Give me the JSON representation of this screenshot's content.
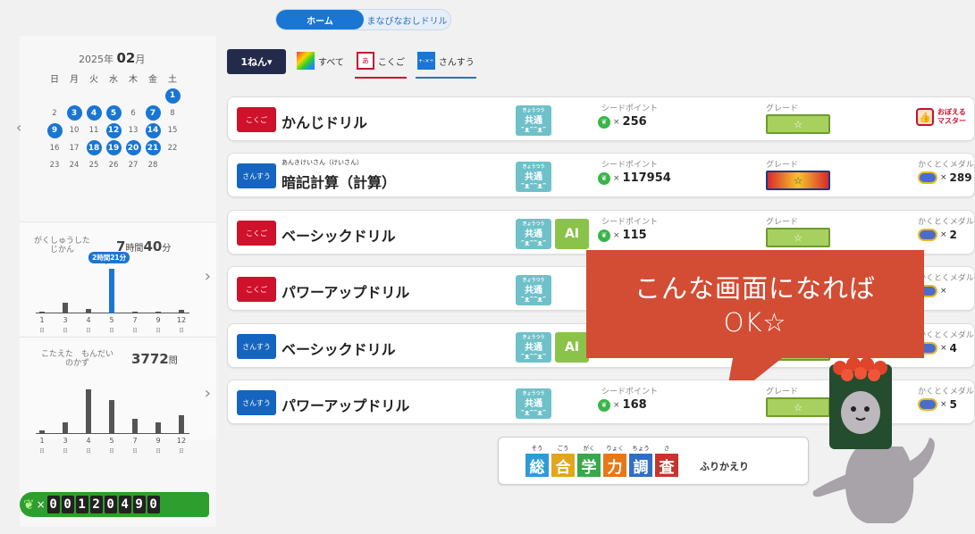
{
  "top_toggle": {
    "home": "ホーム",
    "review": "まなびなおしドリル"
  },
  "calendar": {
    "year": "2025",
    "year_suffix": "年",
    "month": "02",
    "month_suffix": "月",
    "weekdays": [
      "日",
      "月",
      "火",
      "水",
      "木",
      "金",
      "土"
    ],
    "weeks": [
      [
        "",
        "",
        "",
        "",
        "",
        "",
        "1"
      ],
      [
        "2",
        "3",
        "4",
        "5",
        "6",
        "7",
        "8"
      ],
      [
        "9",
        "10",
        "11",
        "12",
        "13",
        "14",
        "15"
      ],
      [
        "16",
        "17",
        "18",
        "19",
        "20",
        "21",
        "22"
      ],
      [
        "23",
        "24",
        "25",
        "26",
        "27",
        "28",
        ""
      ]
    ],
    "active_days": [
      "1",
      "3",
      "4",
      "5",
      "7",
      "9",
      "12",
      "14",
      "18",
      "19",
      "20",
      "21"
    ]
  },
  "study_time": {
    "label_line1": "がくしゅうした",
    "label_line2": "じかん",
    "hours": "7",
    "hours_unit": "時間",
    "minutes": "40",
    "minutes_unit": "分",
    "tooltip": "2時間21分",
    "bars": [
      {
        "tick": "1",
        "value": 3
      },
      {
        "tick": "3",
        "value": 35
      },
      {
        "tick": "4",
        "value": 15
      },
      {
        "tick": "5",
        "value": 141
      },
      {
        "tick": "7",
        "value": 6
      },
      {
        "tick": "9",
        "value": 6
      },
      {
        "tick": "12",
        "value": 12
      }
    ],
    "tick_unit": "日"
  },
  "answered": {
    "label_line1": "こたえた　もんだい",
    "label_line2": "のかず",
    "value": "3772",
    "unit": "問",
    "bars": [
      {
        "tick": "1",
        "value": 1
      },
      {
        "tick": "3",
        "value": 3
      },
      {
        "tick": "4",
        "value": 12
      },
      {
        "tick": "5",
        "value": 9
      },
      {
        "tick": "7",
        "value": 4
      },
      {
        "tick": "9",
        "value": 3
      },
      {
        "tick": "12",
        "value": 5
      }
    ],
    "tick_unit": "日"
  },
  "seed_total": {
    "times": "×",
    "digits": [
      "0",
      "0",
      "1",
      "2",
      "0",
      "4",
      "9",
      "0"
    ]
  },
  "tabs": {
    "grade": "1ねん▾",
    "all": "すべて",
    "kokugo": "こくご",
    "kokugo_icon": "あ",
    "sansu": "さんすう",
    "sansu_icon": "+-×÷"
  },
  "columns": {
    "seed_point": "シードポイント",
    "grade": "グレード",
    "medal": "かくとくメダル"
  },
  "common_badge": {
    "ruby": "きょうつう",
    "text": "共通",
    "faces": "ᵔᴥᵔᵔᴥᵔ"
  },
  "ai_badge": "AI",
  "drills": [
    {
      "subject": "こくご",
      "name": "かんじドリル",
      "seeds": "256",
      "medal": "",
      "master": "おぼえる\nマスター"
    },
    {
      "subject": "さんすう",
      "name": "暗記計算（計算）",
      "ruby": "あんきけいさん（けいさん）",
      "seeds": "117954",
      "medal": "289"
    },
    {
      "subject": "こくご",
      "name": "ベーシックドリル",
      "seeds": "115",
      "medal": "2",
      "ai": true
    },
    {
      "subject": "こくご",
      "name": "パワーアップドリル",
      "seeds": "",
      "medal": ""
    },
    {
      "subject": "さんすう",
      "name": "ベーシックドリル",
      "seeds": "",
      "medal": "4",
      "ai": true
    },
    {
      "subject": "さんすう",
      "name": "パワーアップドリル",
      "seeds": "168",
      "medal": "5"
    }
  ],
  "master_label_1": "おぼえる",
  "master_label_2": "マスター",
  "review": {
    "chars": [
      "総",
      "合",
      "学",
      "力",
      "調",
      "査"
    ],
    "ruby": [
      "そう",
      "ごう",
      "がく",
      "りょく",
      "ちょう",
      "さ"
    ],
    "label": "ふりかえり"
  },
  "callout": {
    "line1": "こんな画面になれば",
    "line2": "OK☆"
  },
  "colors": {
    "accent": "#1976d2",
    "kokugo": "#d0112b",
    "sansu": "#1565c0",
    "callout": "#d24d34",
    "seed": "#39b54a"
  }
}
